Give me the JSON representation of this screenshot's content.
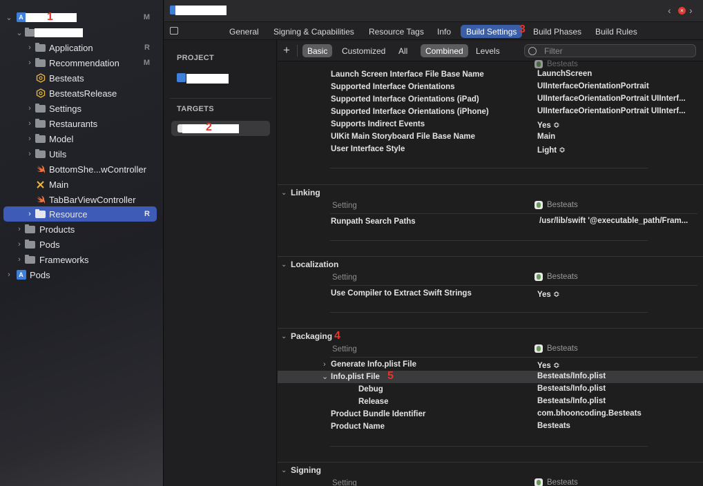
{
  "navigator": {
    "items": [
      {
        "label": "",
        "badge": "M"
      },
      {
        "label": "",
        "badge": ""
      },
      {
        "label": "Application",
        "badge": "R"
      },
      {
        "label": "Recommendation",
        "badge": "M"
      },
      {
        "label": "Besteats",
        "badge": ""
      },
      {
        "label": "BesteatsRelease",
        "badge": ""
      },
      {
        "label": "Settings",
        "badge": ""
      },
      {
        "label": "Restaurants",
        "badge": ""
      },
      {
        "label": "Model",
        "badge": ""
      },
      {
        "label": "Utils",
        "badge": ""
      },
      {
        "label": "BottomShe...wController",
        "badge": ""
      },
      {
        "label": "Main",
        "badge": ""
      },
      {
        "label": "TabBarViewController",
        "badge": ""
      },
      {
        "label": "Resource",
        "badge": "R"
      },
      {
        "label": "Products",
        "badge": ""
      },
      {
        "label": "Pods",
        "badge": ""
      },
      {
        "label": "Frameworks",
        "badge": ""
      },
      {
        "label": "Pods",
        "badge": ""
      }
    ]
  },
  "annotations": {
    "n1": "1",
    "n2": "2",
    "n3": "3",
    "n4": "4",
    "n5": "5"
  },
  "tabs": {
    "general": "General",
    "signing": "Signing & Capabilities",
    "resource_tags": "Resource Tags",
    "info": "Info",
    "build_settings": "Build Settings",
    "build_phases": "Build Phases",
    "build_rules": "Build Rules"
  },
  "targets_panel": {
    "project_header": "PROJECT",
    "targets_header": "TARGETS"
  },
  "filterbar": {
    "add": "+",
    "basic": "Basic",
    "customized": "Customized",
    "all": "All",
    "combined": "Combined",
    "levels": "Levels",
    "filter_placeholder": "Filter"
  },
  "columns": {
    "setting": "Setting",
    "target": "Besteats"
  },
  "top_rows": [
    {
      "name": "Launch Screen Interface File Base Name",
      "value": "LaunchScreen"
    },
    {
      "name": "Supported Interface Orientations",
      "value": "UIInterfaceOrientationPortrait"
    },
    {
      "name": "Supported Interface Orientations (iPad)",
      "value": "UIInterfaceOrientationPortrait UIInterf..."
    },
    {
      "name": "Supported Interface Orientations (iPhone)",
      "value": "UIInterfaceOrientationPortrait UIInterf..."
    },
    {
      "name": "Supports Indirect Events",
      "value": "Yes ≎"
    },
    {
      "name": "UIKit Main Storyboard File Base Name",
      "value": "Main"
    },
    {
      "name": "User Interface Style",
      "value": "Light ≎"
    }
  ],
  "linking": {
    "title": "Linking",
    "rows": [
      {
        "name": "Runpath Search Paths",
        "value": "/usr/lib/swift '@executable_path/Fram..."
      }
    ]
  },
  "localization": {
    "title": "Localization",
    "rows": [
      {
        "name": "Use Compiler to Extract Swift Strings",
        "value": "Yes ≎"
      }
    ]
  },
  "packaging": {
    "title": "Packaging",
    "rows": [
      {
        "name": "Generate Info.plist File",
        "value": "Yes ≎"
      },
      {
        "name": "Info.plist File",
        "value": "Besteats/Info.plist"
      },
      {
        "name": "Debug",
        "value": "Besteats/Info.plist"
      },
      {
        "name": "Release",
        "value": "Besteats/Info.plist"
      },
      {
        "name": "Product Bundle Identifier",
        "value": "com.bhooncoding.Besteats"
      },
      {
        "name": "Product Name",
        "value": "Besteats"
      }
    ]
  },
  "signing": {
    "title": "Signing"
  }
}
